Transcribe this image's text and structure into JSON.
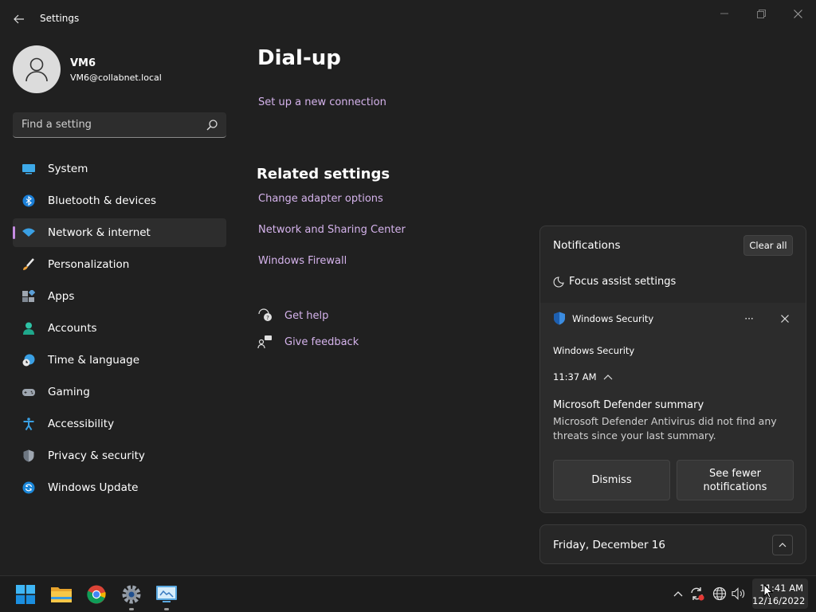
{
  "window": {
    "app_title": "Settings"
  },
  "profile": {
    "name": "VM6",
    "email": "VM6@collabnet.local"
  },
  "search": {
    "placeholder": "Find a setting"
  },
  "sidebar": {
    "items": [
      {
        "label": "System",
        "icon": "system-icon"
      },
      {
        "label": "Bluetooth & devices",
        "icon": "bluetooth-icon"
      },
      {
        "label": "Network & internet",
        "icon": "wifi-icon",
        "selected": true
      },
      {
        "label": "Personalization",
        "icon": "brush-icon"
      },
      {
        "label": "Apps",
        "icon": "apps-icon"
      },
      {
        "label": "Accounts",
        "icon": "accounts-icon"
      },
      {
        "label": "Time & language",
        "icon": "clock-globe-icon"
      },
      {
        "label": "Gaming",
        "icon": "gamepad-icon"
      },
      {
        "label": "Accessibility",
        "icon": "accessibility-icon"
      },
      {
        "label": "Privacy & security",
        "icon": "shield-icon"
      },
      {
        "label": "Windows Update",
        "icon": "update-icon"
      }
    ]
  },
  "main": {
    "title": "Dial-up",
    "setup_link": "Set up a new connection",
    "related_title": "Related settings",
    "related_links": [
      "Change adapter options",
      "Network and Sharing Center",
      "Windows Firewall"
    ],
    "help": {
      "get_help": "Get help",
      "give_feedback": "Give feedback"
    }
  },
  "notifications": {
    "header": "Notifications",
    "clear_all": "Clear all",
    "focus_assist": "Focus assist settings",
    "toast": {
      "app_name": "Windows Security",
      "more": "···",
      "source": "Windows Security",
      "time": "11:37 AM",
      "title": "Microsoft Defender summary",
      "body": "Microsoft Defender Antivirus did not find any threats since your last summary.",
      "dismiss": "Dismiss",
      "see_fewer": "See fewer notifications"
    }
  },
  "calendar": {
    "date": "Friday, December 16"
  },
  "taskbar": {
    "apps": [
      "start-icon",
      "file-explorer-icon",
      "chrome-icon",
      "settings-icon",
      "control-panel-icon"
    ],
    "clock_time": "11:41 AM",
    "clock_date": "12/16/2022"
  },
  "colors": {
    "accent": "#c58ce2",
    "link": "#d5b3ec",
    "background": "#202020"
  }
}
